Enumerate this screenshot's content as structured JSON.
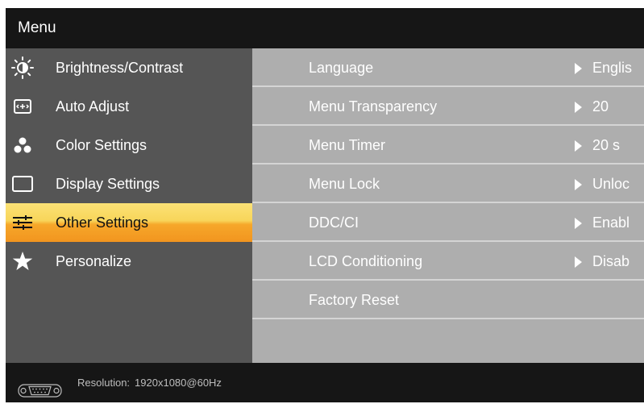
{
  "header": {
    "title": "Menu"
  },
  "sidebar": {
    "items": [
      {
        "label": "Brightness/Contrast",
        "icon": "brightness-icon"
      },
      {
        "label": "Auto Adjust",
        "icon": "auto-adjust-icon"
      },
      {
        "label": "Color Settings",
        "icon": "color-dots-icon"
      },
      {
        "label": "Display Settings",
        "icon": "display-rectangle-icon"
      },
      {
        "label": "Other Settings",
        "icon": "sliders-icon",
        "selected": true
      },
      {
        "label": "Personalize",
        "icon": "star-icon"
      }
    ]
  },
  "settings": {
    "rows": [
      {
        "label": "Language",
        "value": "Englis"
      },
      {
        "label": "Menu Transparency",
        "value": "20"
      },
      {
        "label": "Menu Timer",
        "value": "20 s"
      },
      {
        "label": "Menu Lock",
        "value": "Unloc"
      },
      {
        "label": "DDC/CI",
        "value": "Enabl"
      },
      {
        "label": "LCD Conditioning",
        "value": "Disab"
      },
      {
        "label": "Factory Reset",
        "value": ""
      }
    ]
  },
  "footer": {
    "resolution_label": "Resolution:",
    "resolution_value": "1920x1080@60Hz",
    "icon": "vga-connector-icon"
  },
  "colors": {
    "header_bg": "#161616",
    "left_panel_bg": "#555555",
    "right_panel_bg": "#aeaeae",
    "selected_top": "#fbe276",
    "selected_bottom": "#f2951f"
  }
}
